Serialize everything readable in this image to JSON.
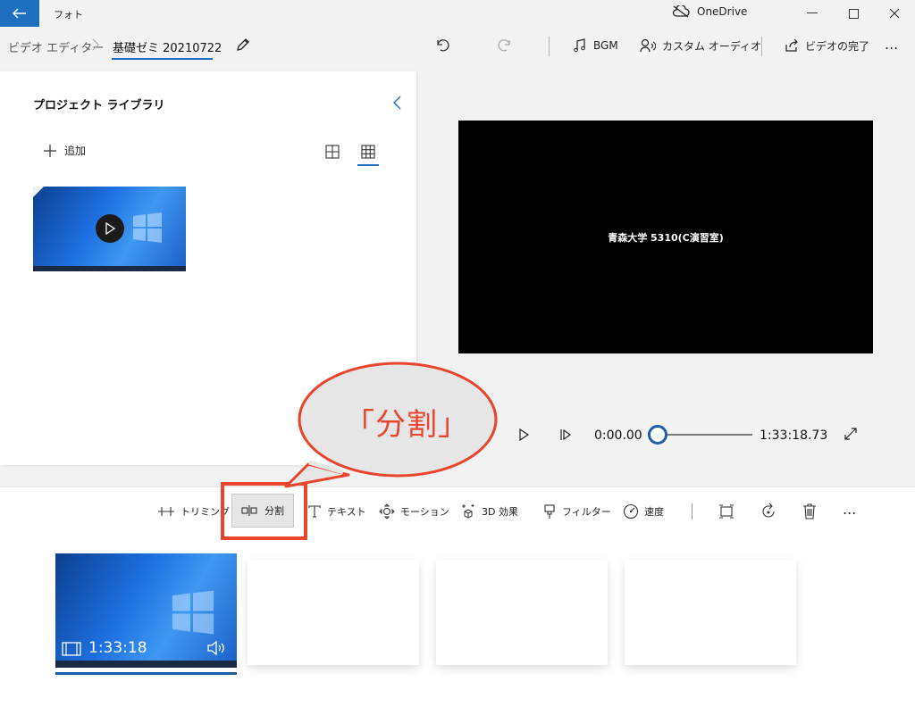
{
  "titlebar": {
    "app_name": "フォト",
    "onedrive_label": "OneDrive"
  },
  "commandbar": {
    "breadcrumb_root": "ビデオ エディター",
    "project_name": "基礎ゼミ 20210722",
    "bgm_label": "BGM",
    "custom_audio_label": "カスタム オーディオ",
    "finish_label": "ビデオの完了",
    "more_label": "..."
  },
  "library": {
    "title": "プロジェクト ライブラリ",
    "add_label": "追加"
  },
  "preview": {
    "overlay_text": "青森大学 5310(C演習室)"
  },
  "playback": {
    "current_time": "0:00.00",
    "total_time": "1:33:18.73",
    "position": 0
  },
  "toolbar": {
    "trim_label": "トリミング",
    "split_label": "分割",
    "text_label": "テキスト",
    "motion_label": "モーション",
    "effects3d_label": "3D 効果",
    "filter_label": "フィルター",
    "speed_label": "速度",
    "more_label": "..."
  },
  "storyboard": {
    "clips": [
      {
        "duration": "1:33:18"
      }
    ],
    "empty_slots": 3
  },
  "callout": {
    "text": "「分割」"
  },
  "colors": {
    "accent": "#1e6fc0",
    "highlight": "#e8452c",
    "callout_fill": "#e6e6e6"
  }
}
